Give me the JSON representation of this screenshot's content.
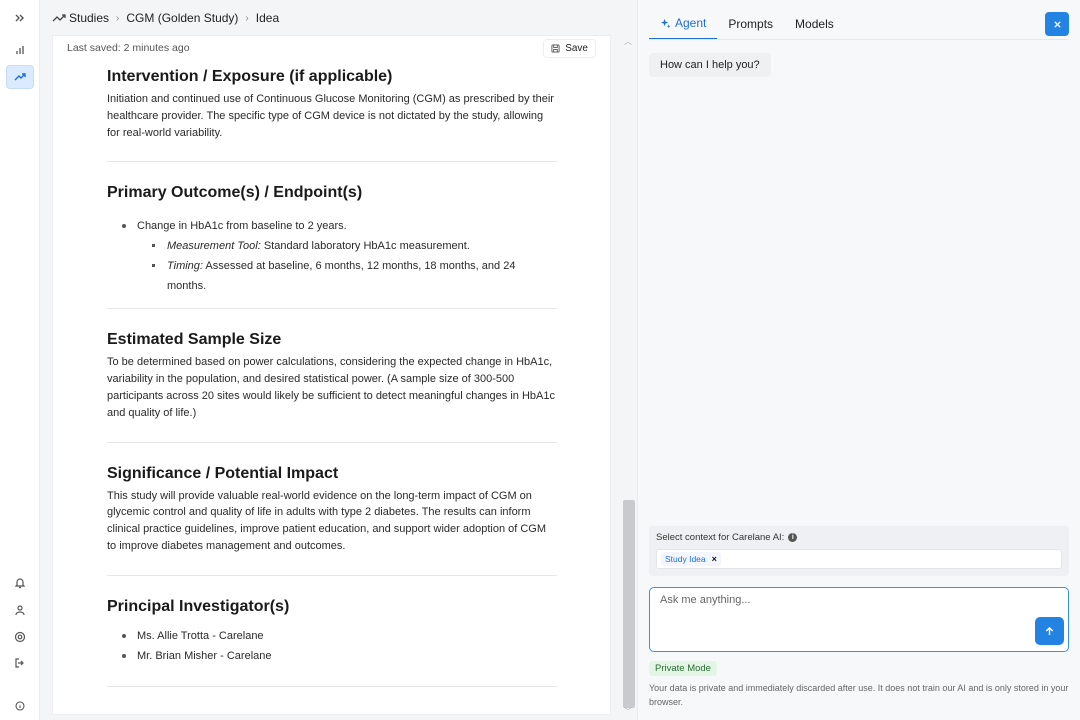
{
  "breadcrumb": {
    "items": [
      "Studies",
      "CGM (Golden Study)",
      "Idea"
    ]
  },
  "document": {
    "last_saved": "Last saved: 2 minutes ago",
    "save_label": "Save",
    "sections": {
      "intervention": {
        "title": "Intervention / Exposure (if applicable)",
        "body": "Initiation and continued use of Continuous Glucose Monitoring (CGM) as prescribed by their healthcare provider. The specific type of CGM device is not dictated by the study, allowing for real-world variability."
      },
      "outcomes": {
        "title": "Primary Outcome(s) / Endpoint(s)",
        "main_item": "Change in HbA1c from baseline to 2 years.",
        "sub_items": [
          {
            "label": "Measurement Tool:",
            "text": " Standard laboratory HbA1c measurement."
          },
          {
            "label": "Timing:",
            "text": " Assessed at baseline, 6 months, 12 months, 18 months, and 24 months."
          }
        ]
      },
      "sample_size": {
        "title": "Estimated Sample Size",
        "body": "To be determined based on power calculations, considering the expected change in HbA1c, variability in the population, and desired statistical power. (A sample size of 300-500 participants across 20 sites would likely be sufficient to detect meaningful changes in HbA1c and quality of life.)"
      },
      "significance": {
        "title": "Significance / Potential Impact",
        "body": "This study will provide valuable real-world evidence on the long-term impact of CGM on glycemic control and quality of life in adults with type 2 diabetes. The results can inform clinical practice guidelines, improve patient education, and support wider adoption of CGM to improve diabetes management and outcomes."
      },
      "investigators": {
        "title": "Principal Investigator(s)",
        "items": [
          "Ms. Allie Trotta - Carelane",
          "Mr. Brian Misher - Carelane"
        ]
      }
    }
  },
  "panel": {
    "tabs": [
      "Agent",
      "Prompts",
      "Models"
    ],
    "greeting": "How can I help you?",
    "context_label": "Select context for Carelane AI:",
    "context_chip": "Study Idea",
    "input_placeholder": "Ask me anything...",
    "private_badge": "Private Mode",
    "private_text": "Your data is private and immediately discarded after use. It does not train our AI and is only stored in your browser."
  },
  "colors": {
    "accent": "#2383e2",
    "active_tab": "#1d6fd6",
    "private_bg": "#e3f6e5"
  },
  "icons": {
    "rail": [
      "expand-icon",
      "bar-chart-icon",
      "trending-icon",
      "bell-icon",
      "user-icon",
      "help-icon",
      "logout-icon",
      "info-icon"
    ]
  }
}
